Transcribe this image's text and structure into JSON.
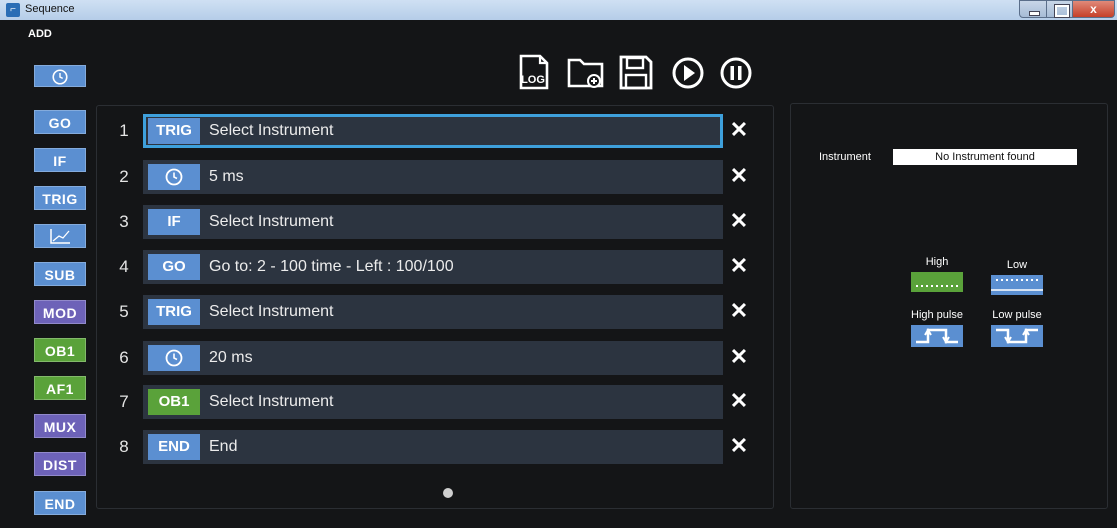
{
  "window": {
    "title": "Sequence",
    "close_glyph": "x"
  },
  "add_panel": {
    "label": "ADD",
    "buttons": [
      {
        "label": "",
        "icon": "clock-icon",
        "color": "#5b8fd1"
      },
      {
        "label": "GO",
        "color": "#5b8fd1"
      },
      {
        "label": "IF",
        "color": "#5b8fd1"
      },
      {
        "label": "TRIG",
        "color": "#5b8fd1"
      },
      {
        "label": "",
        "icon": "chart-icon",
        "color": "#5b8fd1"
      },
      {
        "label": "SUB",
        "color": "#5b8fd1"
      },
      {
        "label": "MOD",
        "color": "#6d62b8"
      },
      {
        "label": "OB1",
        "color": "#5aa23a"
      },
      {
        "label": "AF1",
        "color": "#5aa23a"
      },
      {
        "label": "MUX",
        "color": "#6d62b8"
      },
      {
        "label": "DIST",
        "color": "#6d62b8"
      },
      {
        "label": "END",
        "color": "#5b8fd1"
      }
    ]
  },
  "toolbar": {
    "log_label": "LOG",
    "icons": [
      "log-icon",
      "new-folder-icon",
      "save-icon",
      "play-icon",
      "pause-icon"
    ]
  },
  "steps": [
    {
      "num": "1",
      "tag": "TRIG",
      "tag_color": "#5b8fd1",
      "text": "Select Instrument",
      "selected": true
    },
    {
      "num": "2",
      "tag": "",
      "icon": "clock-icon",
      "tag_color": "#5b8fd1",
      "text": "5 ms"
    },
    {
      "num": "3",
      "tag": "IF",
      "tag_color": "#5b8fd1",
      "text": "Select Instrument"
    },
    {
      "num": "4",
      "tag": "GO",
      "tag_color": "#5b8fd1",
      "text": "Go to: 2 - 100 time - Left : 100/100"
    },
    {
      "num": "5",
      "tag": "TRIG",
      "tag_color": "#5b8fd1",
      "text": "Select Instrument"
    },
    {
      "num": "6",
      "tag": "",
      "icon": "clock-icon",
      "tag_color": "#5b8fd1",
      "text": "20 ms"
    },
    {
      "num": "7",
      "tag": "OB1",
      "tag_color": "#5aa23a",
      "text": "Select Instrument"
    },
    {
      "num": "8",
      "tag": "END",
      "tag_color": "#5b8fd1",
      "text": "End"
    }
  ],
  "delete_glyph": "✕",
  "instrument": {
    "label": "Instrument",
    "value": "No Instrument found",
    "controls": {
      "high": "High",
      "low": "Low",
      "high_pulse": "High pulse",
      "low_pulse": "Low pulse"
    },
    "colors": {
      "high": "#5aa23a",
      "low": "#5b8fd1",
      "pulse": "#5b8fd1"
    }
  },
  "colors": {
    "accent": "#3ea0dc",
    "background": "#141517",
    "row": "#2c3440"
  }
}
